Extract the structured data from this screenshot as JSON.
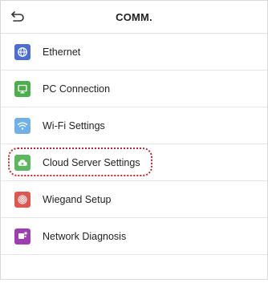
{
  "header": {
    "title": "COMM.",
    "back_icon": "back-arrow-icon"
  },
  "menu": {
    "items": [
      {
        "label": "Ethernet",
        "icon": "globe-icon",
        "color": "#4a6fd1"
      },
      {
        "label": "PC Connection",
        "icon": "monitor-icon",
        "color": "#4cae4c"
      },
      {
        "label": "Wi-Fi Settings",
        "icon": "wifi-icon",
        "color": "#6fb1e8"
      },
      {
        "label": "Cloud Server Settings",
        "icon": "cloud-icon",
        "color": "#5cb85c",
        "highlighted": true
      },
      {
        "label": "Wiegand Setup",
        "icon": "fingerprint-icon",
        "color": "#e0574f"
      },
      {
        "label": "Network Diagnosis",
        "icon": "diagnosis-icon",
        "color": "#9b3fb3"
      }
    ]
  },
  "colors": {
    "highlight": "#c0282b",
    "divider": "#e6e6e6"
  }
}
